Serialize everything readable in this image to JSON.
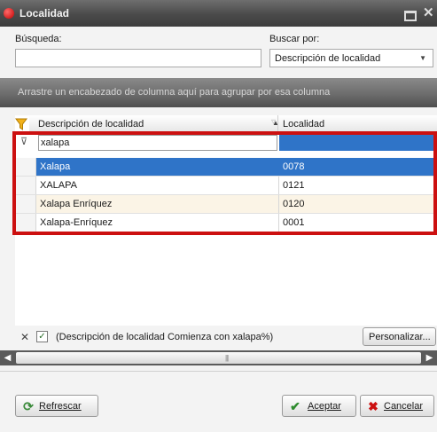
{
  "window": {
    "title": "Localidad",
    "accent_color": "#cc1010",
    "selection_color": "#2f74c8"
  },
  "search": {
    "label": "Búsqueda:",
    "value": "",
    "search_by_label": "Buscar por:",
    "search_by_selected": "Descripción de localidad"
  },
  "group_panel": {
    "hint": "Arrastre un encabezado de columna aquí para agrupar por esa columna"
  },
  "grid": {
    "columns": [
      {
        "label": "Descripción de localidad",
        "sort": "ascending"
      },
      {
        "label": "Localidad"
      }
    ],
    "filter_value": "xalapa",
    "rows": [
      {
        "descripcion": "Xalapa",
        "localidad": "0078",
        "selected": true
      },
      {
        "descripcion": "XALAPA",
        "localidad": "0121"
      },
      {
        "descripcion": "Xalapa Enríquez",
        "localidad": "0120"
      },
      {
        "descripcion": "Xalapa-Enríquez",
        "localidad": "0001"
      }
    ]
  },
  "filter_status": {
    "text": "(Descripción de localidad Comienza con xalapa%)",
    "checked": true,
    "customize_label": "Personalizar..."
  },
  "footer": {
    "refresh_label": "Refrescar",
    "accept_label": "Aceptar",
    "cancel_label": "Cancelar"
  }
}
